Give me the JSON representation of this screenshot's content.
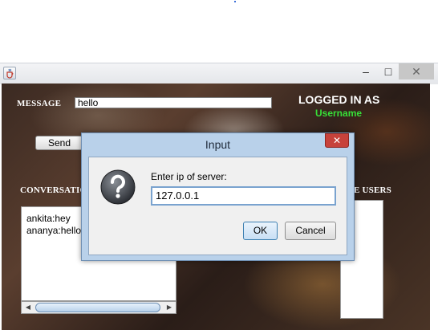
{
  "window": {
    "app_icon": "java-cup-icon",
    "minimize_glyph": "–",
    "maximize_glyph": "□",
    "close_glyph": "✕"
  },
  "main": {
    "message_label": "MESSAGE",
    "message_value": "hello",
    "logged_in_label": "LOGGED IN AS",
    "username": "Username",
    "send_label": "Send",
    "conversation_label": "CONVERSATIO",
    "conversation_lines": [
      "ankita:hey",
      "ananya:hello"
    ],
    "users_label": "E USERS",
    "colors": {
      "username": "#37e037"
    }
  },
  "dialog": {
    "title": "Input",
    "close_glyph": "✕",
    "icon": "question-icon",
    "prompt": "Enter ip of server:",
    "ip_value": "127.0.0.1",
    "ok_label": "OK",
    "cancel_label": "Cancel",
    "colors": {
      "titlebar": "#b9d1ea",
      "close": "#c7423b"
    }
  }
}
